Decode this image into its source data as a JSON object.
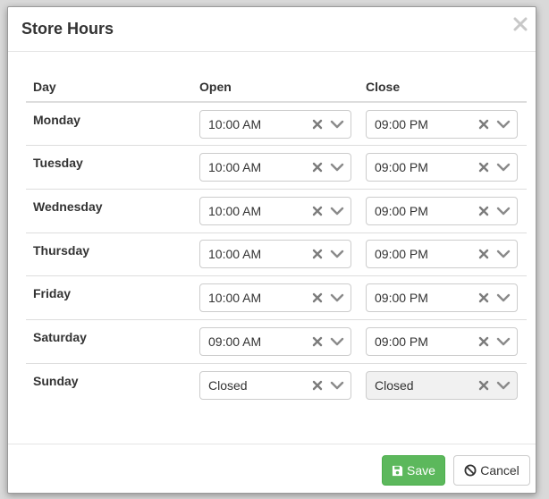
{
  "modal": {
    "title": "Store Hours"
  },
  "table": {
    "headers": {
      "day": "Day",
      "open": "Open",
      "close": "Close"
    },
    "rows": [
      {
        "day": "Monday",
        "open": "10:00 AM",
        "close": "09:00 PM"
      },
      {
        "day": "Tuesday",
        "open": "10:00 AM",
        "close": "09:00 PM"
      },
      {
        "day": "Wednesday",
        "open": "10:00 AM",
        "close": "09:00 PM"
      },
      {
        "day": "Thursday",
        "open": "10:00 AM",
        "close": "09:00 PM"
      },
      {
        "day": "Friday",
        "open": "10:00 AM",
        "close": "09:00 PM"
      },
      {
        "day": "Saturday",
        "open": "09:00 AM",
        "close": "09:00 PM"
      },
      {
        "day": "Sunday",
        "open": "Closed",
        "close": "Closed"
      }
    ]
  },
  "footer": {
    "save_label": "Save",
    "cancel_label": "Cancel"
  },
  "colors": {
    "save_bg": "#5cb85c",
    "border": "#cccccc",
    "disabled_bg": "#f1f1f1"
  },
  "icons": {
    "close": "close-icon",
    "clear": "clear-icon",
    "dropdown": "chevron-down-icon",
    "save": "floppy-disk-icon",
    "cancel": "ban-icon"
  }
}
